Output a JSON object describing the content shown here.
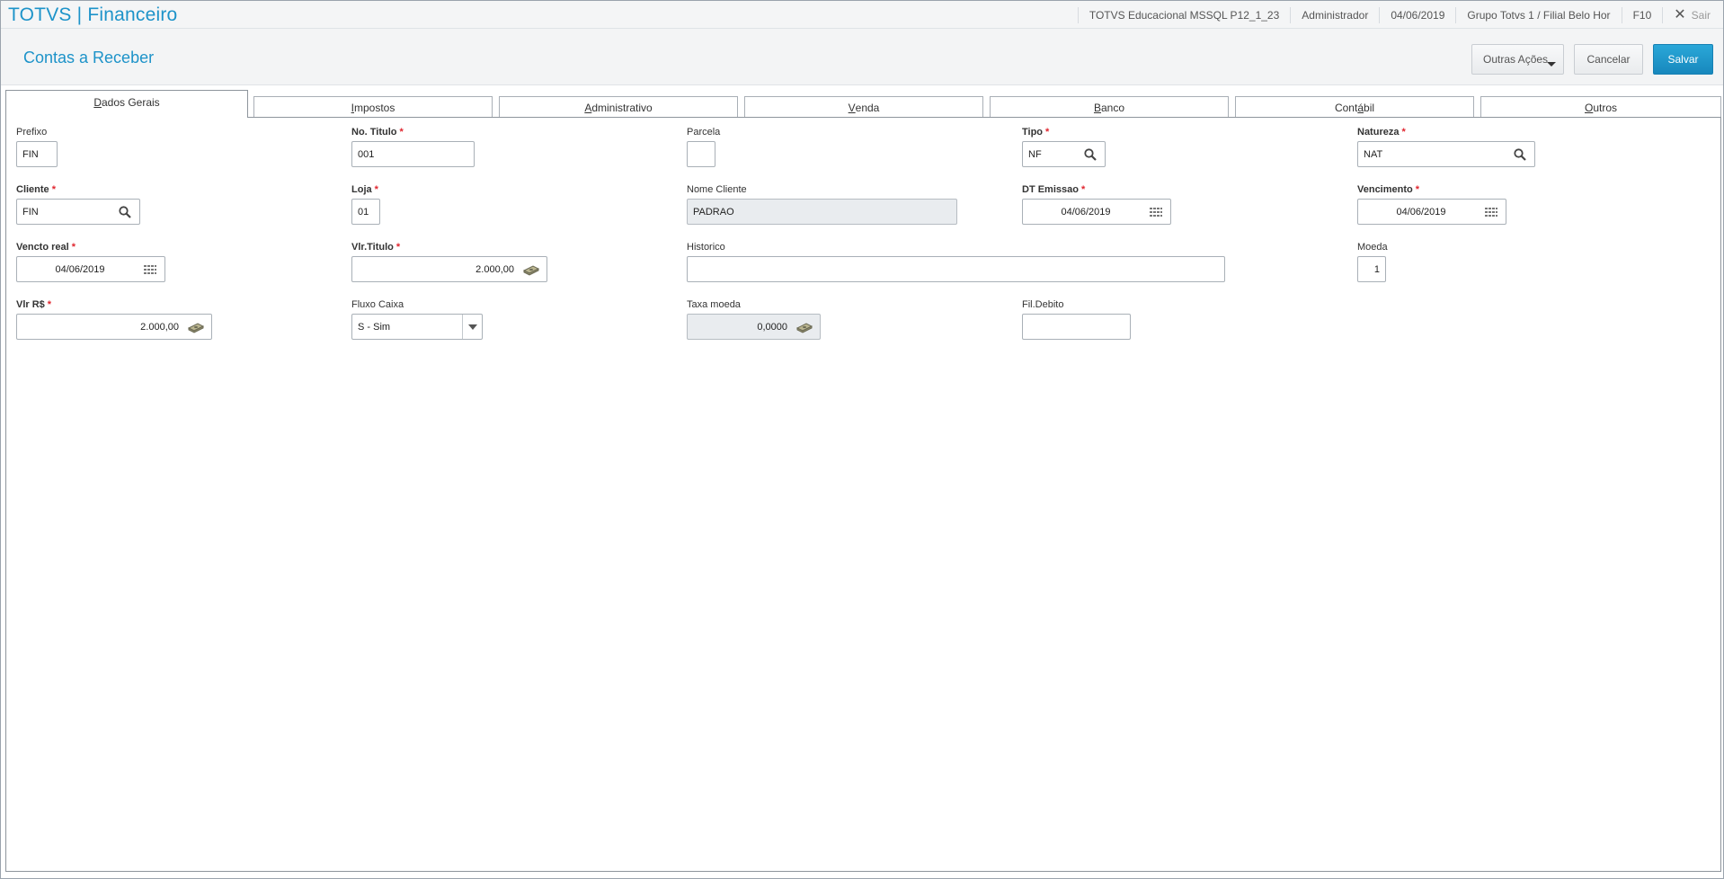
{
  "header": {
    "app_title": "TOTVS | Financeiro",
    "environment": "TOTVS Educacional MSSQL P12_1_23",
    "user": "Administrador",
    "date": "04/06/2019",
    "branch": "Grupo Totvs 1 / Filial Belo Hor",
    "shortcut": "F10",
    "exit_label": "Sair"
  },
  "page": {
    "title": "Contas a Receber",
    "actions": {
      "more_label": "Outras Ações",
      "cancel_label": "Cancelar",
      "save_label": "Salvar"
    }
  },
  "tabs": [
    {
      "pre": "",
      "u": "D",
      "post": "ados Gerais"
    },
    {
      "pre": "",
      "u": "I",
      "post": "mpostos"
    },
    {
      "pre": "",
      "u": "A",
      "post": "dministrativo"
    },
    {
      "pre": "",
      "u": "V",
      "post": "enda"
    },
    {
      "pre": "",
      "u": "B",
      "post": "anco"
    },
    {
      "pre": "Cont",
      "u": "á",
      "post": "bil"
    },
    {
      "pre": "",
      "u": "O",
      "post": "utros"
    }
  ],
  "form": {
    "prefixo": {
      "label": "Prefixo",
      "value": "FIN"
    },
    "no_titulo": {
      "label": "No. Titulo",
      "value": "001"
    },
    "parcela": {
      "label": "Parcela",
      "value": ""
    },
    "tipo": {
      "label": "Tipo",
      "value": "NF"
    },
    "natureza": {
      "label": "Natureza",
      "value": "NAT"
    },
    "cliente": {
      "label": "Cliente",
      "value": "FIN"
    },
    "loja": {
      "label": "Loja",
      "value": "01"
    },
    "nome_cliente": {
      "label": "Nome Cliente",
      "value": "PADRAO"
    },
    "dt_emissao": {
      "label": "DT Emissao",
      "value": "04/06/2019"
    },
    "vencimento": {
      "label": "Vencimento",
      "value": "04/06/2019"
    },
    "vencto_real": {
      "label": "Vencto real",
      "value": "04/06/2019"
    },
    "vlr_titulo": {
      "label": "Vlr.Titulo",
      "value": "2.000,00"
    },
    "historico": {
      "label": "Historico",
      "value": ""
    },
    "moeda": {
      "label": "Moeda",
      "value": "1"
    },
    "vlr_rs": {
      "label": "Vlr R$",
      "value": "2.000,00"
    },
    "fluxo_caixa": {
      "label": "Fluxo Caixa",
      "value": "S - Sim"
    },
    "taxa_moeda": {
      "label": "Taxa moeda",
      "value": "0,0000"
    },
    "fil_debito": {
      "label": "Fil.Debito",
      "value": ""
    }
  },
  "required_marker": "*",
  "colors": {
    "accent": "#1d93c9",
    "required": "#e0262f",
    "save_button": "#1e96ca"
  }
}
